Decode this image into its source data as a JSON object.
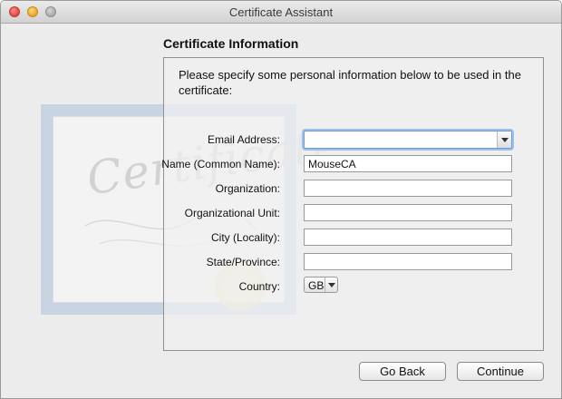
{
  "window": {
    "title": "Certificate Assistant"
  },
  "heading": "Certificate Information",
  "instructions": "Please specify some personal information below to be used in the certificate:",
  "art": {
    "word": "Certificate"
  },
  "form": {
    "email": {
      "label": "Email Address:",
      "value": ""
    },
    "common_name": {
      "label": "Name (Common Name):",
      "value": "MouseCA"
    },
    "organization": {
      "label": "Organization:",
      "value": ""
    },
    "org_unit": {
      "label": "Organizational Unit:",
      "value": ""
    },
    "city": {
      "label": "City (Locality):",
      "value": ""
    },
    "state": {
      "label": "State/Province:",
      "value": ""
    },
    "country": {
      "label": "Country:",
      "value": "GB"
    }
  },
  "buttons": {
    "back": "Go Back",
    "continue": "Continue"
  },
  "colors": {
    "focus_ring": "#9cc0ec",
    "art_frame": "#c9d4e2"
  }
}
